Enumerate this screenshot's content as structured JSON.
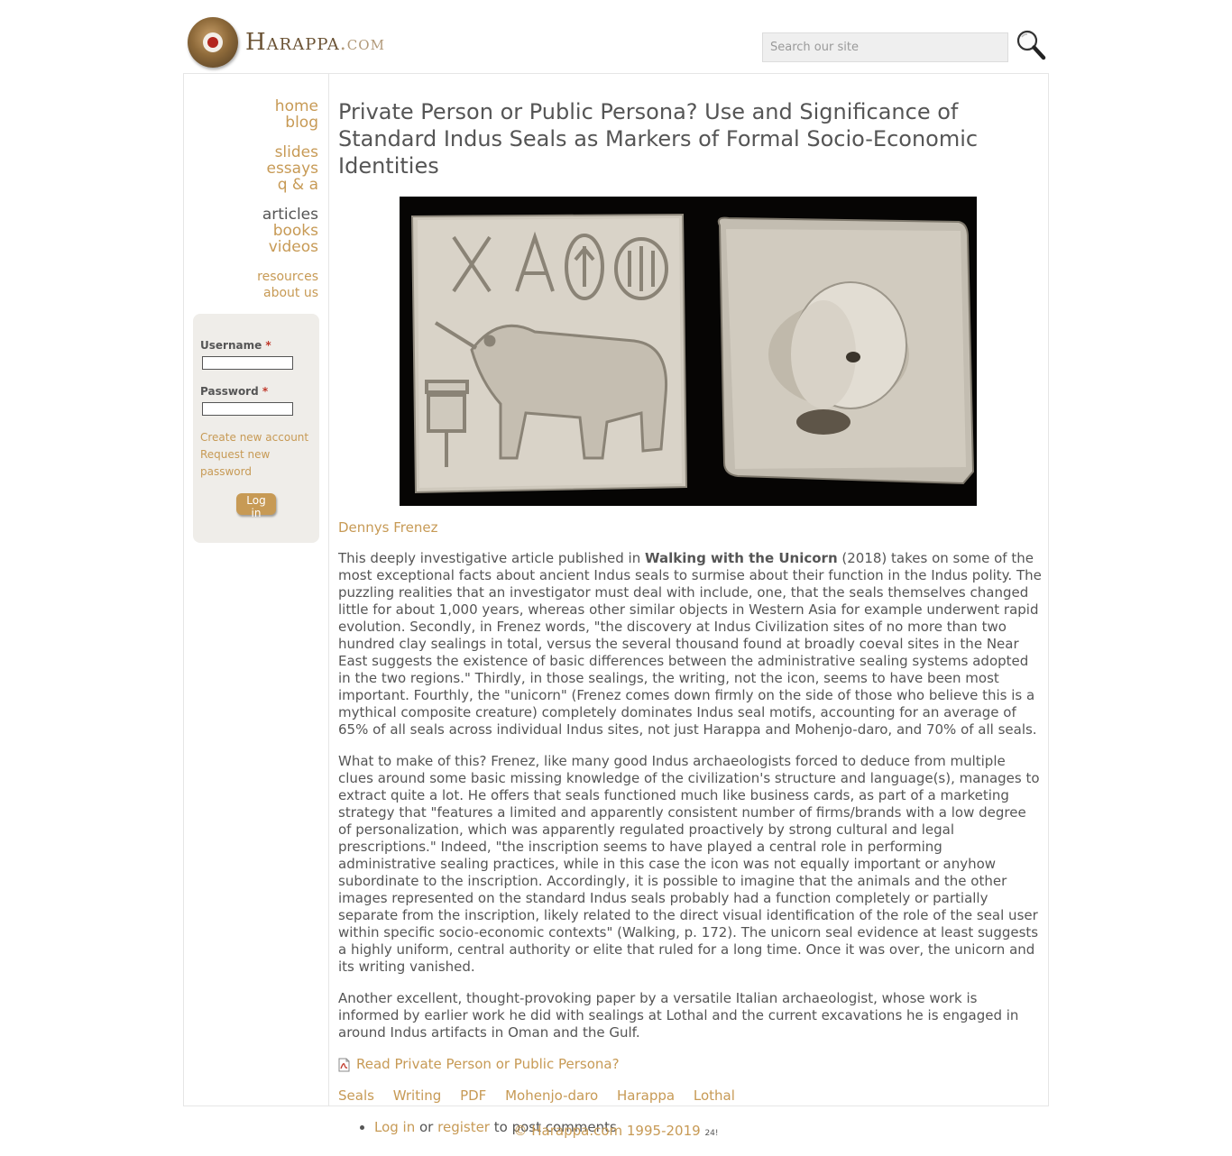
{
  "site": {
    "logo_main": "Harappa",
    "logo_com": ".com",
    "search_placeholder": "Search our site"
  },
  "nav": {
    "group1": [
      "home",
      "blog"
    ],
    "group2": [
      "slides",
      "essays",
      "q & a"
    ],
    "group3": [
      "articles",
      "books",
      "videos"
    ],
    "group4": [
      "resources",
      "about us"
    ],
    "active": "articles"
  },
  "login": {
    "username_label": "Username",
    "password_label": "Password",
    "required_mark": "*",
    "create_account": "Create new account",
    "request_password_line1": "Request new",
    "request_password_line2": "password",
    "submit_label": "Log in"
  },
  "article": {
    "title": "Private Person or Public Persona? Use and Significance of Standard Indus Seals as Markers of Formal Socio-Economic Identities",
    "author": "Dennys Frenez",
    "p1_before": "This deeply investigative article published in ",
    "p1_bold": "Walking with the Unicorn",
    "p1_after": " (2018) takes on some of the most exceptional facts about ancient Indus seals to surmise about their function in the Indus polity. The puzzling realities that an investigator must deal with include, one, that the seals themselves changed little for about 1,000 years, whereas other similar objects in Western Asia for example underwent rapid evolution. Secondly, in Frenez words, \"the discovery at Indus Civilization sites of no more than two hundred clay sealings in total, versus the several thousand found at broadly coeval sites in the Near East suggests the existence of basic differences between the administrative sealing systems adopted in the two regions.\" Thirdly, in those sealings, the writing, not the icon, seems to have been most important. Fourthly, the \"unicorn\" (Frenez comes down firmly on the side of those who believe this is a mythical composite creature) completely dominates Indus seal motifs, accounting for an average of 65% of all seals across individual Indus sites, not just Harappa and Mohenjo-daro, and 70% of all seals.",
    "p2": "What to make of this? Frenez, like many good Indus archaeologists forced to deduce from multiple clues around some basic missing knowledge of the civilization's structure and language(s), manages to extract quite a lot. He offers that seals functioned much like business cards, as part of a marketing strategy that \"features a limited and apparently consistent number of firms/brands with a low degree of personalization, which was apparently regulated proactively by strong cultural and legal prescriptions.\" Indeed, \"the inscription seems to have played a central role in performing administrative sealing practices, while in this case the icon was not equally important or anyhow subordinate to the inscription. Accordingly, it is possible to imagine that the animals and the other images represented on the standard Indus seals probably had a function completely or partially separate from the inscription, likely related to the direct visual identification of the role of the seal user within specific socio-economic contexts\" (Walking, p. 172). The unicorn seal evidence at least suggests a highly uniform, central authority or elite that ruled for a long time. Once it was over, the unicorn and its writing vanished.",
    "p3": "Another excellent, thought-provoking paper by a versatile Italian archaeologist, whose work is informed by earlier work he did with sealings at Lothal and the current excavations he is engaged in around Indus artifacts in Oman and the Gulf.",
    "pdf_link": "Read Private Person or Public Persona?",
    "tags": [
      "Seals",
      "Writing",
      "PDF",
      "Mohenjo-daro",
      "Harappa",
      "Lothal"
    ],
    "comments_login": "Log in",
    "comments_or": " or ",
    "comments_register": "register",
    "comments_after": " to post comments"
  },
  "footer": {
    "copyright": "© Harappa.com 1995-2019",
    "small": "24!"
  },
  "icons": {
    "search": "magnifier-icon",
    "pdf": "pdf-file-icon",
    "logo": "seal-disc-icon"
  },
  "colors": {
    "link": "#c79a55",
    "text": "#555555",
    "login_bg": "#efede9",
    "required": "#c0392b"
  }
}
